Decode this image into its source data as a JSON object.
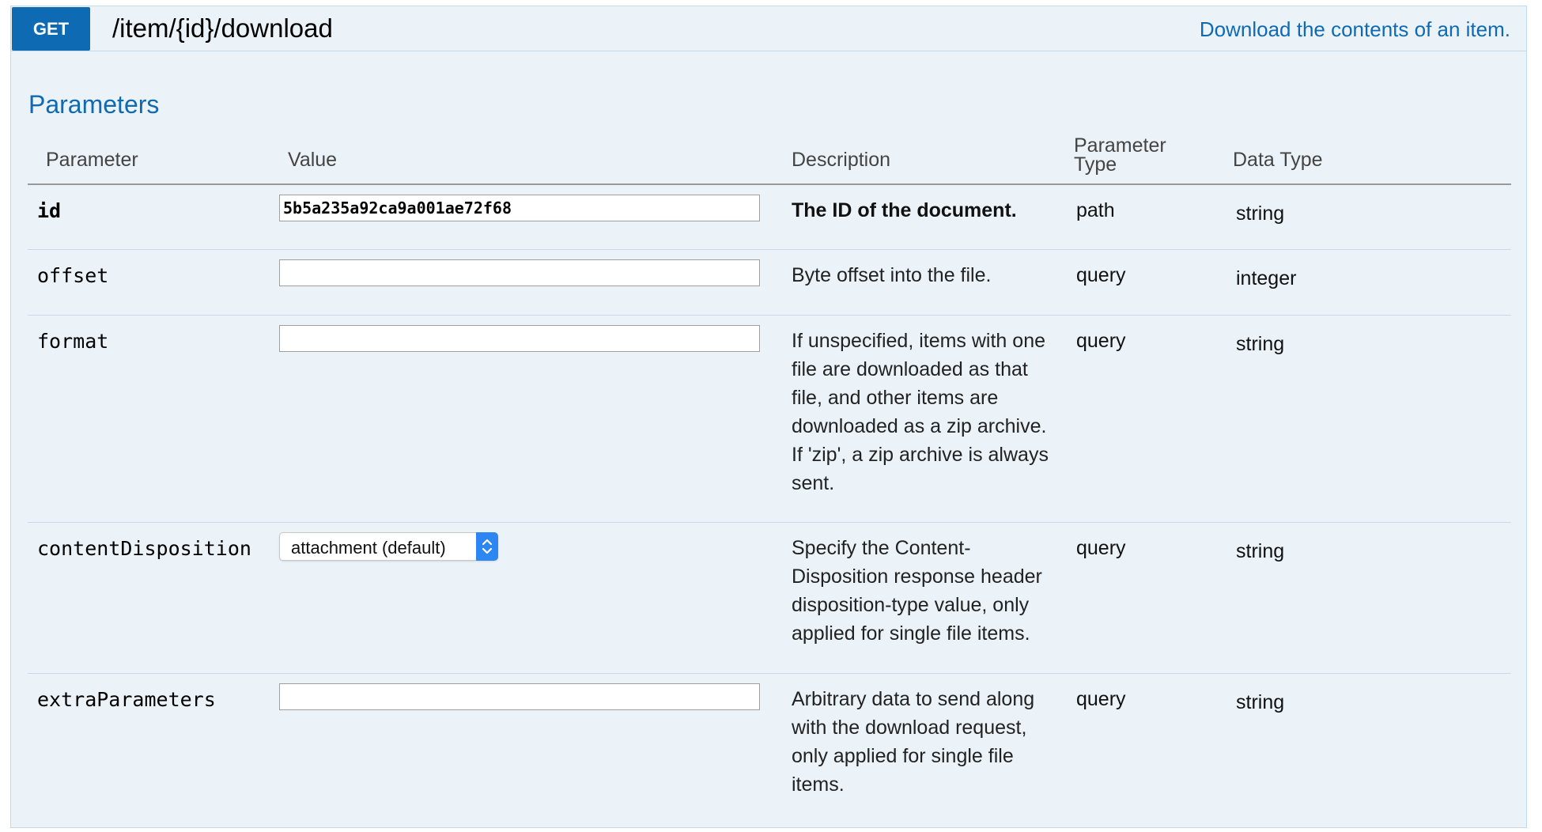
{
  "operation": {
    "method": "GET",
    "path": "/item/{id}/download",
    "summary": "Download the contents of an item."
  },
  "parameters_section": {
    "title": "Parameters",
    "headers": {
      "parameter": "Parameter",
      "value": "Value",
      "description": "Description",
      "param_type_line1": "Parameter",
      "param_type_line2": "Type",
      "data_type": "Data Type"
    },
    "rows": [
      {
        "name": "id",
        "value": "5b5a235a92ca9a001ae72f68",
        "description": "The ID of the document.",
        "param_type": "path",
        "data_type": "string"
      },
      {
        "name": "offset",
        "value": "",
        "description": "Byte offset into the file.",
        "param_type": "query",
        "data_type": "integer"
      },
      {
        "name": "format",
        "value": "",
        "description": "If unspecified, items with one file are downloaded as that file, and other items are downloaded as a zip archive. If 'zip', a zip archive is always sent.",
        "param_type": "query",
        "data_type": "string"
      },
      {
        "name": "contentDisposition",
        "selected_option": "attachment (default)",
        "description": "Specify the Content-Disposition response header disposition-type value, only applied for single file items.",
        "param_type": "query",
        "data_type": "string"
      },
      {
        "name": "extraParameters",
        "value": "",
        "description": "Arbitrary data to send along with the download request, only applied for single file items.",
        "param_type": "query",
        "data_type": "string"
      }
    ]
  },
  "colors": {
    "method_badge": "#0f6ab4",
    "accent_text": "#0f6ab4",
    "panel_background": "#ebf3f9",
    "select_arrow": "#2d86f2"
  },
  "icons": {
    "select_arrow": "chevron-up-down-icon"
  }
}
